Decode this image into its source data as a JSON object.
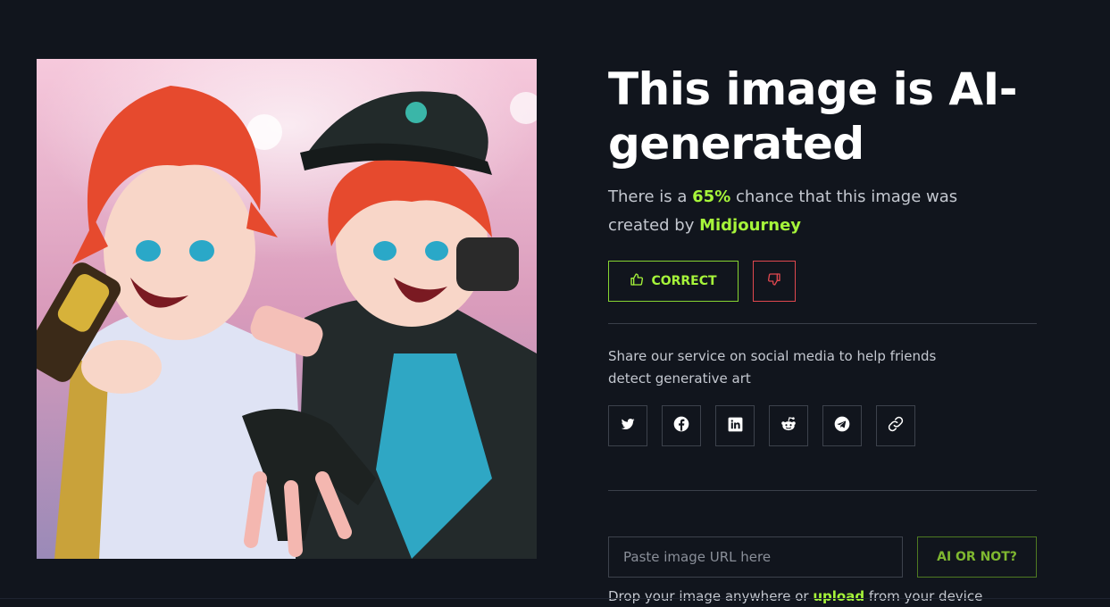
{
  "result": {
    "title": "This image is AI-generated",
    "line_prefix": "There is a ",
    "percent": "65%",
    "line_mid": " chance that this image was created by ",
    "generator": "Midjourney"
  },
  "feedback": {
    "correct_label": "CORRECT",
    "correct_icon": "thumbs-up-icon",
    "wrong_icon": "thumbs-down-icon"
  },
  "share": {
    "text": "Share our service on social media to help friends detect generative art",
    "icons": [
      "twitter-icon",
      "facebook-icon",
      "linkedin-icon",
      "reddit-icon",
      "telegram-icon",
      "link-icon"
    ]
  },
  "checker": {
    "placeholder": "Paste image URL here",
    "submit_label": "AI OR NOT?",
    "drop_prefix": "Drop your image anywhere or ",
    "upload_link": "upload",
    "drop_suffix": " from your device"
  },
  "colors": {
    "background": "#11151d",
    "accent": "#a6f43a",
    "danger": "#e0484f",
    "border": "#3d424c"
  }
}
